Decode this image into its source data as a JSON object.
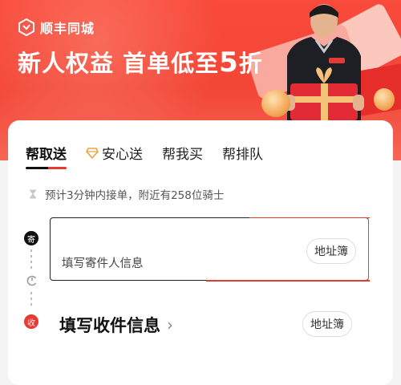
{
  "banner": {
    "brand": "顺丰同城",
    "headline_prefix": "新人权益 首单低至",
    "headline_number": "5",
    "headline_suffix": "折"
  },
  "tabs": [
    {
      "label": "帮取送",
      "active": true
    },
    {
      "label": "安心送",
      "active": false,
      "icon": "diamond-icon"
    },
    {
      "label": "帮我买",
      "active": false
    },
    {
      "label": "帮排队",
      "active": false
    }
  ],
  "eta_text": "预计3分钟内接单，附近有258位骑士",
  "sender": {
    "badge": "寄",
    "hint": "填写寄件人信息",
    "address_book": "地址簿"
  },
  "receiver": {
    "badge": "收",
    "title": "填写收件信息",
    "chevron": "›",
    "address_book": "地址簿"
  },
  "colors": {
    "accent": "#f24636",
    "dark": "#111111",
    "gold": "#e8a33a"
  }
}
